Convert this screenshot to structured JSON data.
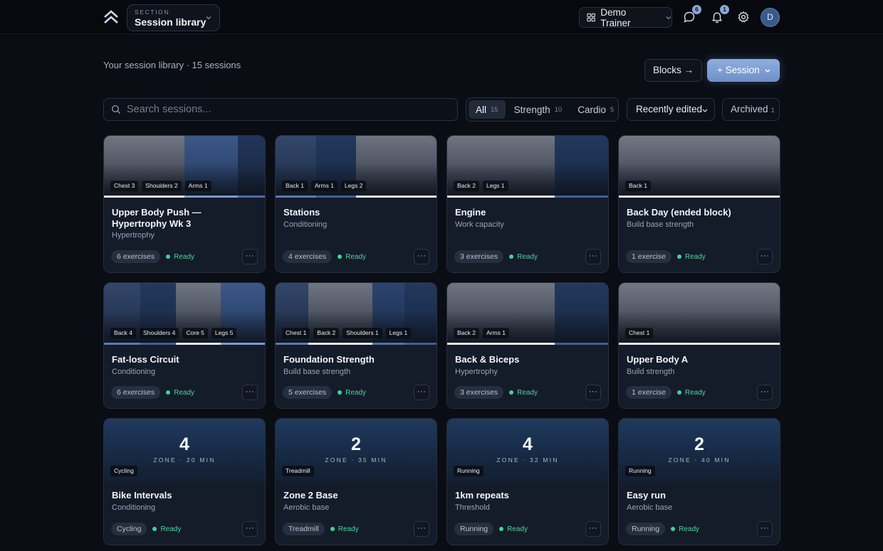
{
  "topbar": {
    "logo_icon": "double-chevron-up-icon",
    "section_kicker": "SECTION",
    "section_value": "Session library",
    "trainer_label": "Demo Trainer",
    "messages_badge": "6",
    "notifications_badge": "1",
    "avatar_initial": "D"
  },
  "header": {
    "library_count": "Your session library · 15 sessions",
    "blocks_label": "Blocks →",
    "session_label": "+ Session"
  },
  "filters": {
    "search_placeholder": "Search sessions...",
    "tabs": [
      {
        "label": "All",
        "count": "15"
      },
      {
        "label": "Strength",
        "count": "10"
      },
      {
        "label": "Cardio",
        "count": "5"
      }
    ],
    "sort_label": "Recently edited",
    "archived_label": "Archived",
    "archived_count": "1"
  },
  "cards": [
    {
      "title": "Upper Body Push — Hypertrophy Wk 3",
      "subtitle": "Hypertrophy",
      "exercises": "6 exercises",
      "status": "Ready",
      "chips": [
        "Chest 3",
        "Shoulders 2",
        "Arms 1"
      ]
    },
    {
      "title": "Stations",
      "subtitle": "Conditioning",
      "exercises": "4 exercises",
      "status": "Ready",
      "chips": [
        "Back 1",
        "Arms 1",
        "Legs 2"
      ]
    },
    {
      "title": "Engine",
      "subtitle": "Work capacity",
      "exercises": "3 exercises",
      "status": "Ready",
      "chips": [
        "Back 2",
        "Legs 1"
      ]
    },
    {
      "title": "Back Day (ended block)",
      "subtitle": "Build base strength",
      "exercises": "1 exercise",
      "status": "Ready",
      "chips": [
        "Back 1"
      ]
    },
    {
      "title": "Fat-loss Circuit",
      "subtitle": "Conditioning",
      "exercises": "6 exercises",
      "status": "Ready",
      "chips": [
        "Back 4",
        "Shoulders 4",
        "Core 5",
        "Legs 5"
      ]
    },
    {
      "title": "Foundation Strength",
      "subtitle": "Build base strength",
      "exercises": "5 exercises",
      "status": "Ready",
      "chips": [
        "Chest 1",
        "Back 2",
        "Shoulders 1",
        "Legs 1"
      ]
    },
    {
      "title": "Back & Biceps",
      "subtitle": "Hypertrophy",
      "exercises": "3 exercises",
      "status": "Ready",
      "chips": [
        "Back 2",
        "Arms 1"
      ]
    },
    {
      "title": "Upper Body A",
      "subtitle": "Build strength",
      "exercises": "1 exercise",
      "status": "Ready",
      "chips": [
        "Chest 1"
      ]
    },
    {
      "title": "Bike Intervals",
      "subtitle": "Conditioning",
      "big_number": "4",
      "zone": "ZONE · 20 MIN",
      "tag": "Cycling",
      "pill": "Cycling",
      "status": "Ready"
    },
    {
      "title": "Zone 2 Base",
      "subtitle": "Aerobic base",
      "big_number": "2",
      "zone": "ZONE · 35 MIN",
      "tag": "Treadmill",
      "pill": "Treadmill",
      "status": "Ready"
    },
    {
      "title": "1km repeats",
      "subtitle": "Threshold",
      "big_number": "4",
      "zone": "ZONE · 32 MIN",
      "tag": "Running",
      "pill": "Running",
      "status": "Ready"
    },
    {
      "title": "Easy run",
      "subtitle": "Aerobic base",
      "big_number": "2",
      "zone": "ZONE · 40 MIN",
      "tag": "Running",
      "pill": "Running",
      "status": "Ready"
    }
  ],
  "more_label": "···",
  "colors": {
    "accent": "#7f9fd6",
    "ready": "#3ed39a",
    "background": "#0a0d14",
    "card": "#141b29"
  }
}
